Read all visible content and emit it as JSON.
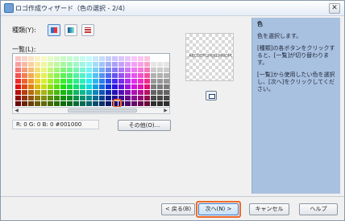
{
  "window": {
    "title": "ロゴ作成ウィザード（色の選択 - 2/4）",
    "close_glyph": "✕"
  },
  "kind": {
    "label": "種類(Y):",
    "options": [
      {
        "icon": "palette-grid-icon",
        "color": "#2d6fc0",
        "selected": true
      },
      {
        "icon": "gradient-swatch-icon",
        "color": "#3aa0b8",
        "selected": false
      },
      {
        "icon": "color-stripes-icon",
        "color": "#c23a3a",
        "selected": false
      }
    ]
  },
  "list": {
    "label": "一覧(L):"
  },
  "palette": {
    "selected_color": "#001000"
  },
  "rgb_readout": "R: 0 G: 0 B: 0   #001000",
  "other_button": "その他(O)...",
  "preview": {
    "text": "ABCDEFGHIJKLMNOPQRSTUVWXYZ",
    "tool_icon": "preview-frame-icon"
  },
  "help": {
    "title": "色",
    "lines": [
      "色を選択します。",
      "[種類]の各ボタンをクリックすると、[一覧]が切り替わります。",
      "[一覧]から使用したい色を選択し、[次へ]をクリックしてください。"
    ]
  },
  "buttons": {
    "back": "< 戻る(B)",
    "next": "次へ(N) >",
    "cancel": "キャンセル",
    "help": "ヘルプ"
  }
}
